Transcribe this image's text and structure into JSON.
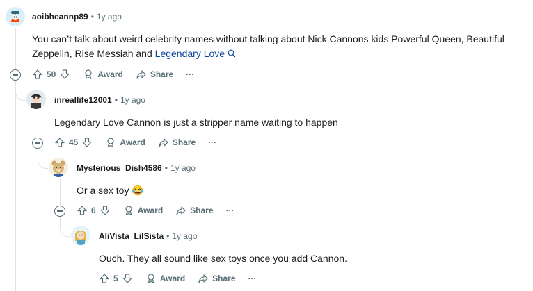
{
  "comments": [
    {
      "username": "aoibheannp89",
      "time": "1y ago",
      "text_before_link": "You can’t talk about weird celebrity names without talking about Nick Cannons kids Powerful Queen, Beautiful Zeppelin, Rise Messiah and ",
      "link_text": "Legendary Love",
      "votes": "50",
      "award_label": "Award",
      "share_label": "Share",
      "more_label": "···"
    },
    {
      "username": "inreallife12001",
      "time": "1y ago",
      "text": "Legendary Love Cannon is just a stripper name waiting to happen",
      "votes": "45",
      "award_label": "Award",
      "share_label": "Share",
      "more_label": "···"
    },
    {
      "username": "Mysterious_Dish4586",
      "time": "1y ago",
      "text": "Or a sex toy",
      "emoji": "😂",
      "votes": "6",
      "award_label": "Award",
      "share_label": "Share",
      "more_label": "···"
    },
    {
      "username": "AliVista_LilSista",
      "time": "1y ago",
      "text": "Ouch. They all sound like sex toys once you add Cannon.",
      "votes": "5",
      "award_label": "Award",
      "share_label": "Share",
      "more_label": "···"
    }
  ],
  "separator": "•",
  "colors": {
    "text": "#1c1c1c",
    "meta": "#576f76",
    "link": "#0a449b",
    "thread": "#dfe3e6"
  }
}
